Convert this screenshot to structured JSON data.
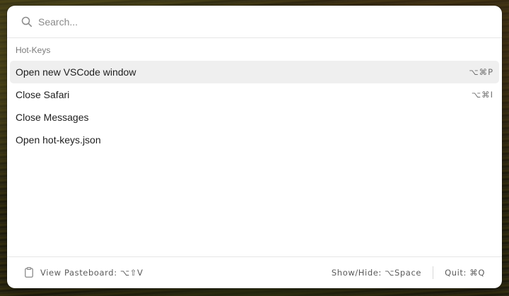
{
  "search": {
    "placeholder": "Search...",
    "value": ""
  },
  "section": {
    "title": "Hot-Keys"
  },
  "items": [
    {
      "label": "Open new VSCode window",
      "shortcut": "⌥⌘P",
      "selected": true
    },
    {
      "label": "Close Safari",
      "shortcut": "⌥⌘I",
      "selected": false
    },
    {
      "label": "Close Messages",
      "shortcut": "",
      "selected": false
    },
    {
      "label": "Open hot-keys.json",
      "shortcut": "",
      "selected": false
    }
  ],
  "footer": {
    "pasteboard_label": "View Pasteboard: ⌥⇧V",
    "show_hide_label": "Show/Hide: ⌥Space",
    "quit_label": "Quit: ⌘Q"
  },
  "icons": {
    "search": "search-icon",
    "pasteboard": "clipboard-icon"
  },
  "colors": {
    "selected_row": "#efefef",
    "panel": "#ffffff"
  }
}
